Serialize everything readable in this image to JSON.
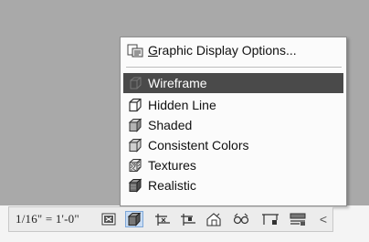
{
  "menu": {
    "header": {
      "label_prefix": "",
      "label_accel": "G",
      "label_rest": "raphic Display Options..."
    },
    "items": [
      {
        "label": "Wireframe",
        "icon": "wireframe-icon",
        "selected": true
      },
      {
        "label": "Hidden Line",
        "icon": "hidden-line-icon"
      },
      {
        "label": "Shaded",
        "icon": "shaded-icon"
      },
      {
        "label": "Consistent Colors",
        "icon": "consistent-colors-icon"
      },
      {
        "label": "Textures",
        "icon": "textures-icon"
      },
      {
        "label": "Realistic",
        "icon": "realistic-icon"
      }
    ]
  },
  "status_bar": {
    "scale": "1/16\" = 1'-0\"",
    "controls": [
      "detail-level-icon",
      "visual-style-icon",
      "crop-view-icon",
      "show-crop-region-icon",
      "unlock-3d-view-icon",
      "temporary-hide-icon",
      "reveal-hidden-icon",
      "analytical-model-icon"
    ],
    "overflow": "<"
  },
  "colors": {
    "viewport": "#a9a9a9",
    "selected_row": "#4a4a4a",
    "active_control": "#c8dcf3"
  }
}
